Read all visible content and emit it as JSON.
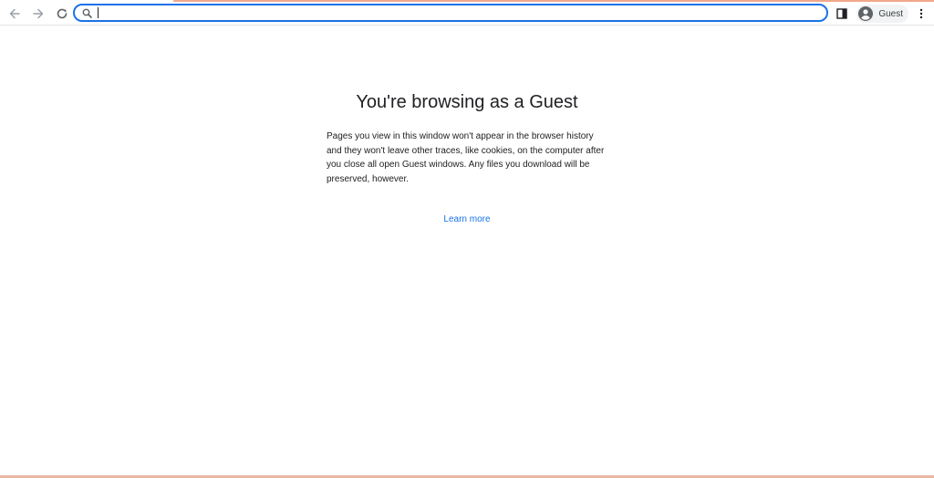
{
  "toolbar": {
    "back_icon": "arrow-left-icon",
    "forward_icon": "arrow-right-icon",
    "reload_icon": "reload-icon",
    "omnibox": {
      "value": "",
      "placeholder": "",
      "icon": "search-icon"
    },
    "side_panel_icon": "side-panel-icon",
    "profile": {
      "icon": "person-icon",
      "label": "Guest"
    },
    "menu_icon": "more-vert-icon"
  },
  "main": {
    "title": "You're browsing as a Guest",
    "description": "Pages you view in this window won't appear in the browser history and they won't leave other traces, like cookies, on the computer after you close all open Guest windows. Any files you download will be preserved, however.",
    "learn_more": "Learn more"
  },
  "colors": {
    "accent": "#1a73e8",
    "text": "#202124",
    "icon": "#5f6368",
    "top_accent": "#f0a98b"
  }
}
